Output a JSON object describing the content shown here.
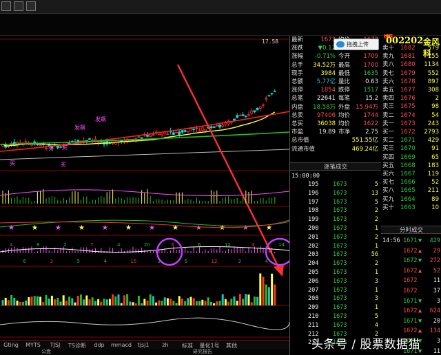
{
  "header": {
    "price_high_label": "17.58"
  },
  "chart_data": {
    "type": "candlestick",
    "note_labels": [
      "买",
      "买",
      "买",
      "买"
    ],
    "tags": [
      "发飙",
      "发飙"
    ],
    "osc_numbers": [
      "4",
      "6",
      "8",
      "3",
      "2",
      "5",
      "7",
      "4",
      "4",
      "15",
      "20",
      "3",
      "3",
      "5",
      "6",
      "12",
      "12",
      "3",
      "4",
      "4",
      "14"
    ],
    "ma_lines": [
      "yellow",
      "red",
      "green",
      "white"
    ]
  },
  "bottom_tabs": [
    "Gting",
    "MYTS",
    "TJSJ",
    "TS诊断",
    "ddp",
    "mmacd",
    "tjsj1",
    "zh",
    "标准",
    "量化1号",
    "其他"
  ],
  "bottom_sub": [
    "公盘",
    "研究报告"
  ],
  "stock": {
    "code": "002202",
    "name": "金风科",
    "badge": "HMT"
  },
  "sync_button": "拖拽上传",
  "quote_left": [
    {
      "l": "最新",
      "v": "1673",
      "vc": "q-red"
    },
    {
      "l": "涨跌",
      "v": "▼0.12",
      "vc": "q-grn"
    },
    {
      "l": "涨幅",
      "v": "-0.71%",
      "vc": "q-grn"
    },
    {
      "l": "总手",
      "v": "34.52万",
      "vc": "q-yel"
    },
    {
      "l": "现手",
      "v": "3984",
      "vc": "q-yel"
    },
    {
      "l": "总额",
      "v": "5.77亿",
      "vc": "q-cyn"
    },
    {
      "l": "涨停",
      "v": "1854",
      "vc": "q-red"
    },
    {
      "l": "总笔",
      "v": "22641",
      "vc": "q-wht"
    },
    {
      "l": "内盘",
      "v": "18.58万",
      "vc": "q-grn"
    },
    {
      "l": "总卖",
      "v": "97406",
      "vc": "q-red"
    },
    {
      "l": "总买",
      "v": "36038",
      "vc": "q-yel"
    },
    {
      "l": "市盈",
      "v": "19.89",
      "vc": "q-wht"
    },
    {
      "l": "总市值",
      "v": "",
      "vc": "q-wht"
    },
    {
      "l": "流通市值",
      "v": "",
      "vc": "q-wht"
    }
  ],
  "quote_mid": [
    {
      "l": "均价",
      "v": "1673",
      "vc": "q-red"
    },
    {
      "l": "",
      "v": "",
      "vc": "q-wht"
    },
    {
      "l": "今开",
      "v": "1709",
      "vc": "q-red"
    },
    {
      "l": "最高",
      "v": "1700",
      "vc": "q-red"
    },
    {
      "l": "最低",
      "v": "1635",
      "vc": "q-grn"
    },
    {
      "l": "量比",
      "v": "0.63",
      "vc": "q-wht"
    },
    {
      "l": "跌停",
      "v": "1517",
      "vc": "q-grn"
    },
    {
      "l": "每笔",
      "v": "15.2",
      "vc": "q-wht"
    },
    {
      "l": "外盘",
      "v": "15.94万",
      "vc": "q-red"
    },
    {
      "l": "均价",
      "v": "1744",
      "vc": "q-red"
    },
    {
      "l": "均价",
      "v": "1622",
      "vc": "q-red"
    },
    {
      "l": "市净",
      "v": "2.75",
      "vc": "q-wht"
    },
    {
      "l": "",
      "v": "551.55亿",
      "vc": "q-yel"
    },
    {
      "l": "",
      "v": "469.24亿",
      "vc": "q-yel"
    }
  ],
  "order_book": [
    {
      "lvl": "卖十",
      "p": "1682",
      "pc": "q-red",
      "v": "579"
    },
    {
      "lvl": "卖九",
      "p": "1681",
      "pc": "q-red",
      "v": "155"
    },
    {
      "lvl": "卖八",
      "p": "1680",
      "pc": "q-red",
      "v": "1134"
    },
    {
      "lvl": "卖七",
      "p": "1679",
      "pc": "q-red",
      "v": "552"
    },
    {
      "lvl": "卖六",
      "p": "1678",
      "pc": "q-red",
      "v": "897"
    },
    {
      "lvl": "卖五",
      "p": "1677",
      "pc": "q-red",
      "v": "308"
    },
    {
      "lvl": "卖四",
      "p": "1676",
      "pc": "q-red",
      "v": "2"
    },
    {
      "lvl": "卖三",
      "p": "1675",
      "pc": "q-red",
      "v": "98"
    },
    {
      "lvl": "卖二",
      "p": "1674",
      "pc": "q-red",
      "v": "54"
    },
    {
      "lvl": "卖一",
      "p": "1673",
      "pc": "q-red",
      "v": "243"
    },
    {
      "lvl": "买一",
      "p": "1672",
      "pc": "q-red",
      "v": "2793"
    },
    {
      "lvl": "买二",
      "p": "1671",
      "pc": "q-grn",
      "v": "429"
    },
    {
      "lvl": "买三",
      "p": "1670",
      "pc": "q-grn",
      "v": "91"
    },
    {
      "lvl": "买四",
      "p": "1669",
      "pc": "q-grn",
      "v": "65"
    },
    {
      "lvl": "买五",
      "p": "1668",
      "pc": "q-grn",
      "v": "183"
    },
    {
      "lvl": "买六",
      "p": "1667",
      "pc": "q-grn",
      "v": "119"
    },
    {
      "lvl": "买七",
      "p": "1666",
      "pc": "q-grn",
      "v": "52"
    },
    {
      "lvl": "买八",
      "p": "1665",
      "pc": "q-grn",
      "v": "211"
    },
    {
      "lvl": "买九",
      "p": "1664",
      "pc": "q-grn",
      "v": "89"
    },
    {
      "lvl": "买十",
      "p": "1663",
      "pc": "q-grn",
      "v": "10"
    }
  ],
  "tick_header": "逐笔成交",
  "tick_header2": "分时成交",
  "tick_first_time": "15:00:00",
  "ticks": [
    {
      "n": "195",
      "p": "1673",
      "v": "5"
    },
    {
      "n": "196",
      "p": "1673",
      "v": "13"
    },
    {
      "n": "197",
      "p": "1673",
      "v": "5"
    },
    {
      "n": "198",
      "p": "1673",
      "v": "2"
    },
    {
      "n": "199",
      "p": "1673",
      "v": "2"
    },
    {
      "n": "200",
      "p": "1673",
      "v": "1"
    },
    {
      "n": "201",
      "p": "1673",
      "v": "2"
    },
    {
      "n": "202",
      "p": "1673",
      "v": "1"
    },
    {
      "n": "203",
      "p": "1673",
      "v": "56"
    },
    {
      "n": "204",
      "p": "1673",
      "v": "2"
    },
    {
      "n": "205",
      "p": "1673",
      "v": "1"
    },
    {
      "n": "206",
      "p": "1673",
      "v": "3"
    },
    {
      "n": "207",
      "p": "1673",
      "v": "1"
    },
    {
      "n": "208",
      "p": "1673",
      "v": "3"
    },
    {
      "n": "209",
      "p": "1673",
      "v": "1"
    },
    {
      "n": "210",
      "p": "1673",
      "v": "5"
    },
    {
      "n": "211",
      "p": "1673",
      "v": "4"
    },
    {
      "n": "212",
      "p": "1673",
      "v": "2"
    },
    {
      "n": "213",
      "p": "1673",
      "v": "3"
    }
  ],
  "ticks2": [
    {
      "t": "14:56",
      "p": "1671",
      "d": "▼",
      "v": "429",
      "pc": "q-grn",
      "vc": "q-grn"
    },
    {
      "t": "",
      "p": "1672",
      "d": "▲",
      "v": "29",
      "pc": "q-red",
      "vc": "q-red"
    },
    {
      "t": "",
      "p": "1672",
      "d": "▼",
      "v": "272",
      "pc": "q-grn",
      "vc": "q-red"
    },
    {
      "t": "",
      "p": "1672",
      "d": "▲",
      "v": "52",
      "pc": "q-red",
      "vc": "q-red"
    },
    {
      "t": "",
      "p": "1672",
      "d": "",
      "v": "11",
      "pc": "q-red",
      "vc": "q-wht"
    },
    {
      "t": "",
      "p": "1672",
      "d": "",
      "v": "37",
      "pc": "q-red",
      "vc": "q-wht"
    },
    {
      "t": "",
      "p": "1671",
      "d": "▼",
      "v": "3",
      "pc": "q-grn",
      "vc": "q-wht"
    },
    {
      "t": "",
      "p": "1672",
      "d": "▲",
      "v": "624",
      "pc": "q-red",
      "vc": "q-red"
    },
    {
      "t": "",
      "p": "1671",
      "d": "▼",
      "v": "20",
      "pc": "q-grn",
      "vc": "q-wht"
    },
    {
      "t": "",
      "p": "1672",
      "d": "▲",
      "v": "134",
      "pc": "q-red",
      "vc": "q-red"
    },
    {
      "t": "",
      "p": "1671",
      "d": "▼",
      "v": "3",
      "pc": "q-grn",
      "vc": "q-wht"
    },
    {
      "t": "",
      "p": "1671",
      "d": "▼",
      "v": "11",
      "pc": "q-grn",
      "vc": "q-wht"
    }
  ],
  "watermark": "头条号 / 股票数据猫"
}
